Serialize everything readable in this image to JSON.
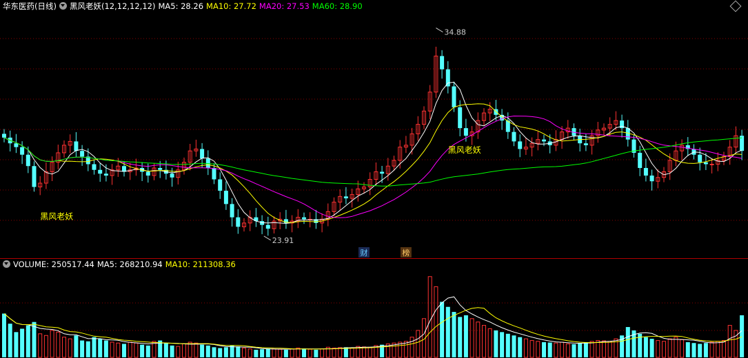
{
  "header": {
    "stock_name": "华东医药(日线)",
    "indicator_name": "黑风老妖(12,12,12,12)",
    "ma5_label": "MA5: 28.26",
    "ma10_label": "MA10: 27.72",
    "ma20_label": "MA20: 27.53",
    "ma60_label": "MA60: 28.90"
  },
  "volume_header": {
    "volume_label": "VOLUME: 250517.44",
    "ma5_label": "MA5: 268210.94",
    "ma10_label": "MA10: 211308.36"
  },
  "annotations": {
    "high_price": "34.88",
    "low_price": "23.91",
    "signal_text_1": "黑风老妖",
    "signal_text_2": "黑风老妖",
    "badge_cai": "财",
    "badge_bang": "榜"
  },
  "colors": {
    "up": "#ff3232",
    "down": "#54ffff",
    "ma5": "#ffffff",
    "ma10": "#ffff00",
    "ma20": "#ff00ff",
    "ma60": "#00ff00",
    "grid": "#8b0000"
  },
  "chart_data": {
    "type": "candlestick",
    "price_ylim": [
      23.0,
      35.7
    ],
    "highest": 34.88,
    "lowest": 23.91,
    "closes": [
      29.1,
      28.8,
      28.6,
      28.2,
      27.6,
      26.5,
      26.7,
      27.3,
      27.8,
      28.3,
      28.7,
      28.9,
      28.4,
      28.1,
      27.7,
      27.4,
      27.2,
      27.1,
      27.4,
      27.6,
      27.3,
      27.4,
      27.5,
      27.3,
      27.1,
      27.5,
      27.4,
      27.2,
      27.0,
      27.4,
      27.8,
      28.4,
      28.5,
      28.0,
      27.5,
      26.9,
      26.3,
      25.6,
      24.9,
      24.4,
      24.6,
      24.9,
      24.7,
      24.5,
      24.3,
      24.7,
      24.8,
      24.6,
      24.7,
      24.9,
      24.8,
      24.8,
      24.6,
      24.8,
      25.2,
      25.7,
      26.0,
      25.9,
      26.1,
      26.4,
      26.5,
      26.9,
      27.3,
      27.2,
      27.6,
      27.9,
      28.6,
      28.7,
      29.3,
      29.8,
      30.5,
      31.5,
      33.4,
      32.7,
      31.8,
      30.7,
      29.6,
      29.2,
      29.4,
      30.0,
      30.4,
      30.6,
      30.3,
      30.0,
      29.4,
      28.9,
      28.5,
      28.6,
      28.8,
      29.0,
      28.9,
      28.7,
      29.0,
      29.4,
      29.6,
      29.2,
      28.8,
      28.7,
      29.2,
      29.5,
      29.6,
      29.8,
      30.0,
      29.6,
      29.0,
      28.3,
      27.5,
      27.1,
      26.8,
      27.0,
      27.3,
      27.9,
      28.4,
      28.7,
      28.5,
      28.2,
      27.8,
      27.7,
      27.7,
      27.9,
      28.1,
      28.6,
      29.2,
      28.4
    ],
    "volume_ylim": [
      0,
      520000
    ],
    "volume": [
      260000,
      200000,
      150000,
      170000,
      190000,
      210000,
      140000,
      130000,
      160000,
      150000,
      120000,
      110000,
      130000,
      100000,
      95000,
      120000,
      110000,
      100000,
      90000,
      85000,
      80000,
      90000,
      85000,
      75000,
      70000,
      95000,
      100000,
      85000,
      70000,
      65000,
      80000,
      90000,
      85000,
      75000,
      70000,
      60000,
      55000,
      60000,
      70000,
      65000,
      55000,
      50000,
      45000,
      48000,
      52000,
      50000,
      48000,
      45000,
      50000,
      55000,
      52000,
      48000,
      45000,
      50000,
      60000,
      55000,
      58000,
      60000,
      55000,
      65000,
      62000,
      60000,
      70000,
      75000,
      80000,
      85000,
      90000,
      95000,
      120000,
      160000,
      230000,
      480000,
      420000,
      330000,
      300000,
      270000,
      240000,
      250000,
      230000,
      210000,
      190000,
      170000,
      160000,
      150000,
      140000,
      130000,
      120000,
      110000,
      100000,
      95000,
      90000,
      88000,
      85000,
      90000,
      80000,
      78000,
      85000,
      90000,
      95000,
      100000,
      98000,
      95000,
      110000,
      130000,
      180000,
      160000,
      140000,
      120000,
      110000,
      100000,
      95000,
      110000,
      120000,
      105000,
      90000,
      85000,
      80000,
      85000,
      90000,
      95000,
      100000,
      190000,
      160000,
      250000
    ]
  }
}
